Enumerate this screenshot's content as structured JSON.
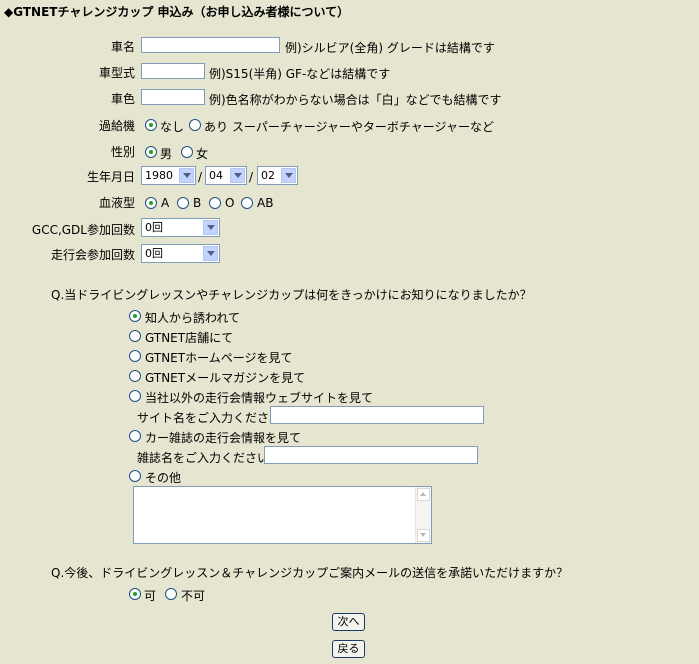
{
  "title": "◆GTNETチャレンジカップ 申込み（お申し込み者様について）",
  "fields": {
    "car_name": {
      "label": "車名",
      "value": "",
      "hint": "例)シルビア(全角) グレードは結構です"
    },
    "car_model": {
      "label": "車型式",
      "value": "",
      "hint": "例)S15(半角) GF-などは結構です"
    },
    "car_color": {
      "label": "車色",
      "value": "",
      "hint": "例)色名称がわからない場合は「白」などでも結構です"
    },
    "turbo": {
      "label": "過給機",
      "options": [
        "なし",
        "あり"
      ],
      "selected": "なし",
      "hint": "スーパーチャージャーやターボチャージャーなど"
    },
    "gender": {
      "label": "性別",
      "options": [
        "男",
        "女"
      ],
      "selected": "男"
    },
    "birthdate": {
      "label": "生年月日",
      "year": "1980",
      "month": "04",
      "day": "02",
      "sep": "/"
    },
    "blood": {
      "label": "血液型",
      "options": [
        "A",
        "B",
        "O",
        "AB"
      ],
      "selected": "A"
    },
    "gcc_count": {
      "label": "GCC,GDL参加回数",
      "value": "0回"
    },
    "run_count": {
      "label": "走行会参加回数",
      "value": "0回"
    }
  },
  "q1": {
    "question": "Q.当ドライビングレッスンやチャレンジカップは何をきっかけにお知りになりましたか？",
    "options": [
      "知人から誘われて",
      "GTNET店舗にて",
      "GTNETホームページを見て",
      "GTNETメールマガジンを見て",
      "当社以外の走行会情報ウェブサイトを見て",
      "カー雑誌の走行会情報を見て",
      "その他"
    ],
    "selected_index": 0,
    "site_prompt": "サイト名をご入力ください。",
    "site_value": "",
    "magazine_prompt": "雑誌名をご入力ください。",
    "magazine_value": "",
    "other_text": ""
  },
  "q2": {
    "question": "Q.今後、ドライビングレッスン＆チャレンジカップご案内メールの送信を承諾いただけますか？",
    "options": [
      "可",
      "不可"
    ],
    "selected": "可"
  },
  "buttons": {
    "next": "次へ",
    "back": "戻る"
  }
}
